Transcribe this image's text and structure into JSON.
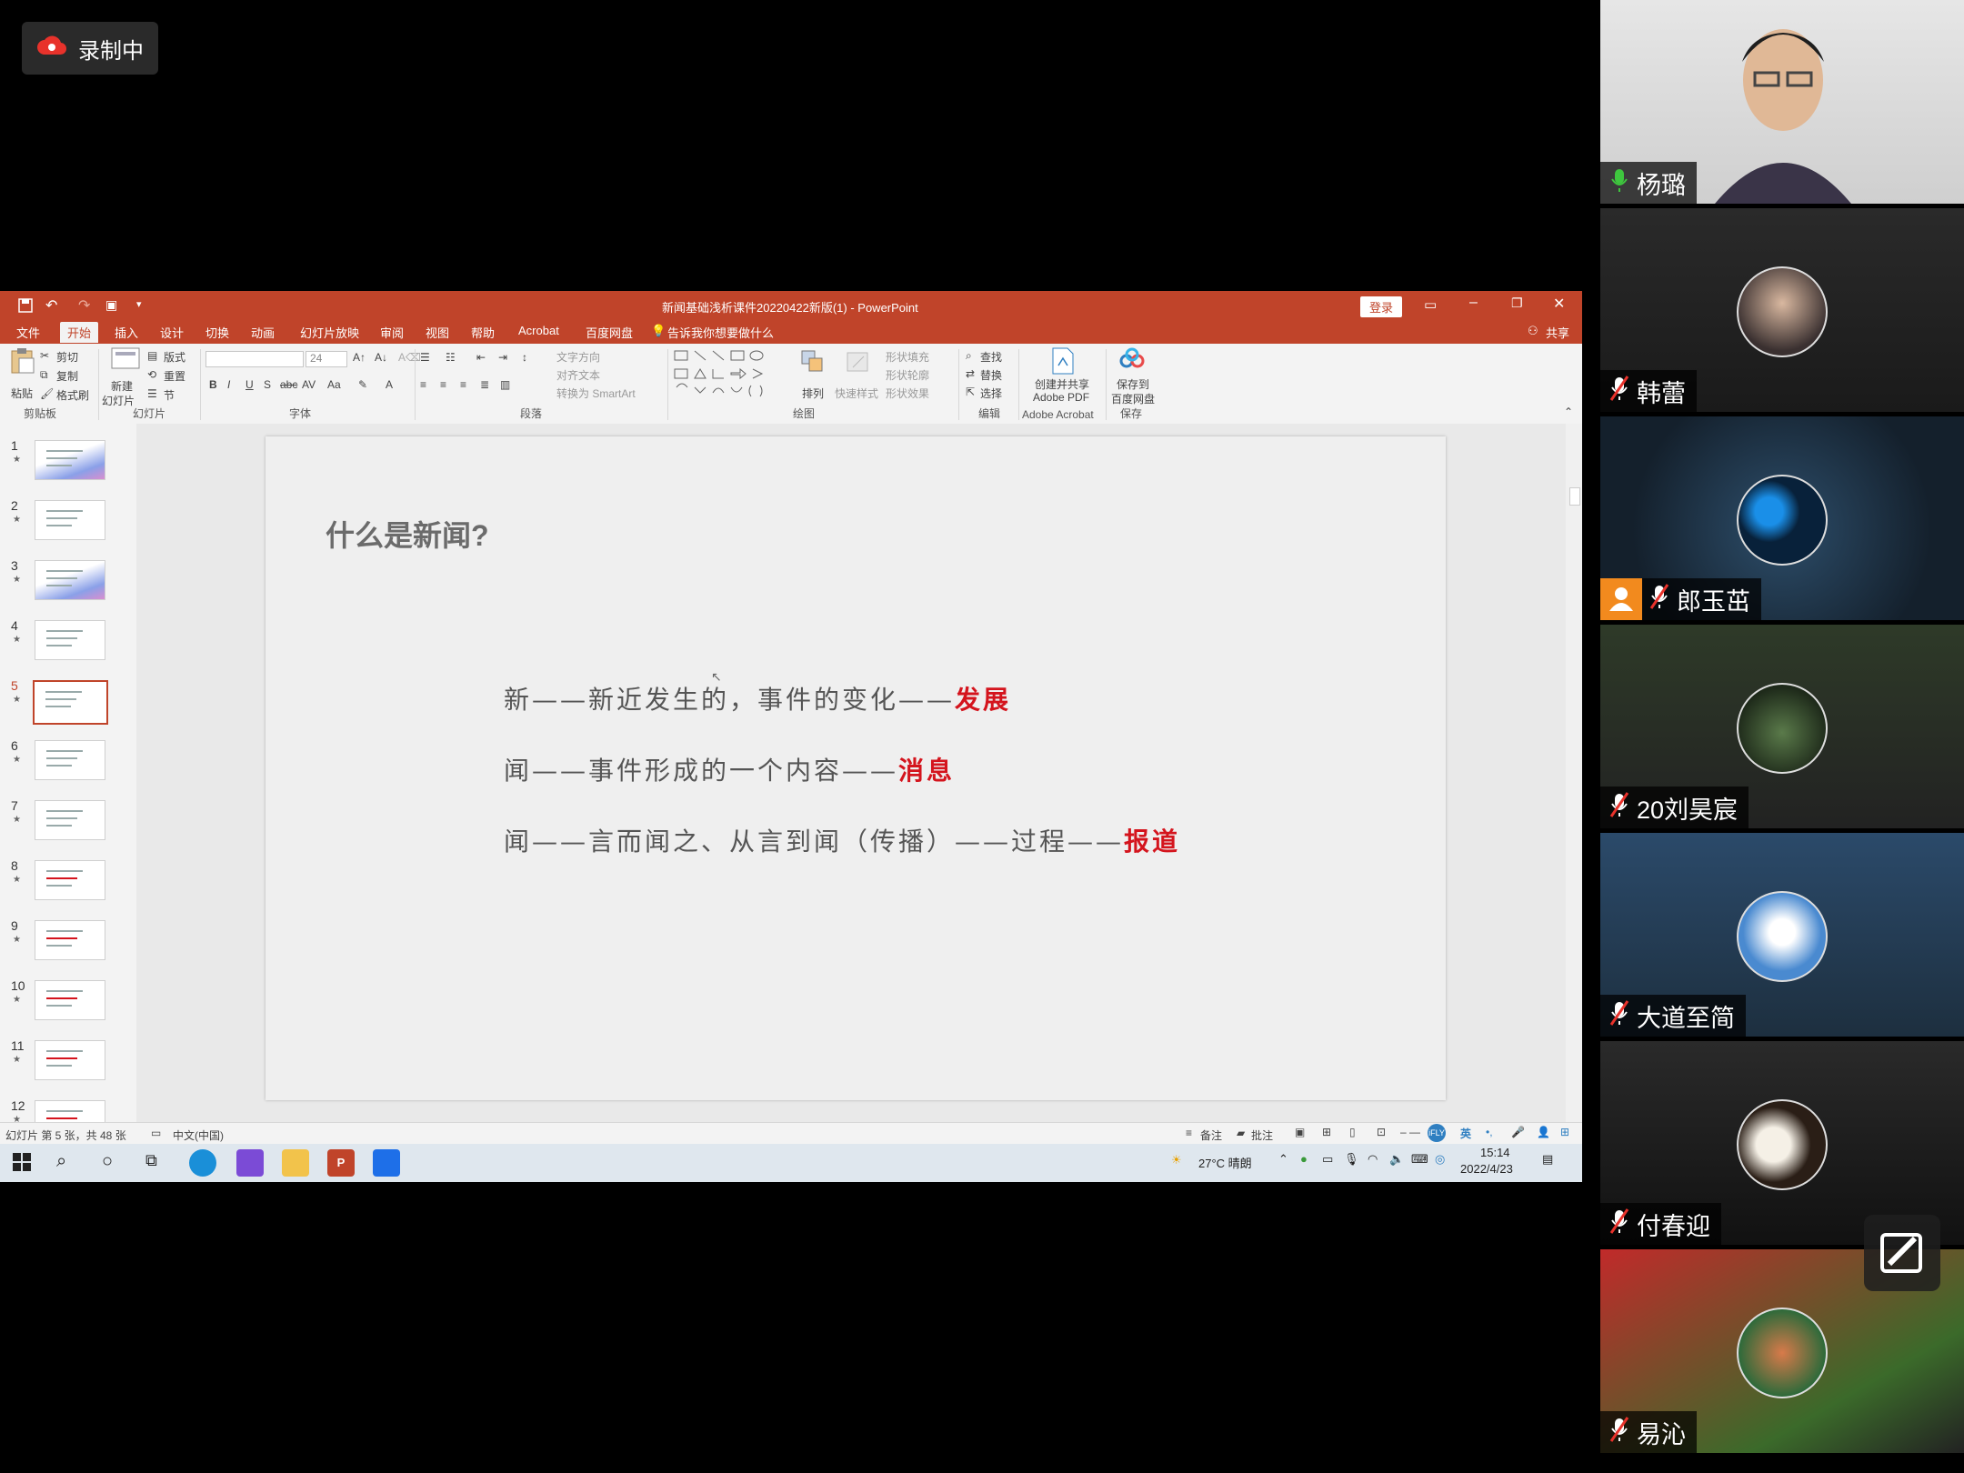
{
  "recording": {
    "label": "录制中"
  },
  "powerpoint": {
    "title": "新闻基础浅析课件20220422新版(1)  -  PowerPoint",
    "login_label": "登录",
    "share_label": "共享",
    "tell_me": "告诉我你想要做什么",
    "menu": [
      "文件",
      "开始",
      "插入",
      "设计",
      "切换",
      "动画",
      "幻灯片放映",
      "审阅",
      "视图",
      "帮助",
      "Acrobat",
      "百度网盘"
    ],
    "ribbon": {
      "paste": "粘贴",
      "cut": "剪切",
      "copy": "复制",
      "format_painter": "格式刷",
      "clipboard": "剪贴板",
      "new_slide_line1": "新建",
      "new_slide_line2": "幻灯片",
      "layout": "版式",
      "reset": "重置",
      "section": "节",
      "slides_group": "幻灯片",
      "font_size": "24",
      "font_group": "字体",
      "text_direction": "文字方向",
      "align_text": "对齐文本",
      "smartart": "转换为 SmartArt",
      "paragraph_group": "段落",
      "arrange": "排列",
      "quick_styles": "快速样式",
      "shape_fill": "形状填充",
      "shape_outline": "形状轮廓",
      "shape_effects": "形状效果",
      "drawing_group": "绘图",
      "find": "查找",
      "replace": "替换",
      "select": "选择",
      "editing_group": "编辑",
      "create_pdf_line1": "创建并共享",
      "create_pdf_line2": "Adobe PDF",
      "acrobat_group": "Adobe Acrobat",
      "save_baidu_line1": "保存到",
      "save_baidu_line2": "百度网盘",
      "save_group": "保存"
    },
    "thumbnails": [
      "1",
      "2",
      "3",
      "4",
      "5",
      "6",
      "7",
      "8",
      "9",
      "10",
      "11",
      "12"
    ],
    "selected_slide": 5,
    "slide": {
      "title": "什么是新闻?",
      "lines": [
        {
          "text": "新——新近发生的，事件的变化——",
          "highlight": "发展"
        },
        {
          "text": "闻——事件形成的一个内容——",
          "highlight": "消息"
        },
        {
          "text": "闻——言而闻之、从言到闻（传播）——过程——",
          "highlight": "报道"
        }
      ]
    },
    "status": {
      "slide_count": "幻灯片 第 5 张，共 48 张",
      "language": "中文(中国)",
      "notes": "备注",
      "comments": "批注"
    },
    "taskbar": {
      "weather": "27°C 晴朗",
      "time": "15:14",
      "date": "2022/4/23",
      "ime": "英"
    }
  },
  "participants": [
    {
      "name": "杨璐",
      "muted": false,
      "video": true
    },
    {
      "name": "韩蕾",
      "muted": true,
      "video": false
    },
    {
      "name": "郎玉茁",
      "muted": true,
      "video": false,
      "host_badge": true
    },
    {
      "name": "20刘昊宸",
      "muted": true,
      "video": false
    },
    {
      "name": "大道至简",
      "muted": true,
      "video": false
    },
    {
      "name": "付春迎",
      "muted": true,
      "video": false
    },
    {
      "name": "易沁",
      "muted": true,
      "video": false
    }
  ],
  "colors": {
    "ppt_red": "#c0442a",
    "highlight_red": "#d4141d",
    "mic_on": "#3ec63e"
  }
}
